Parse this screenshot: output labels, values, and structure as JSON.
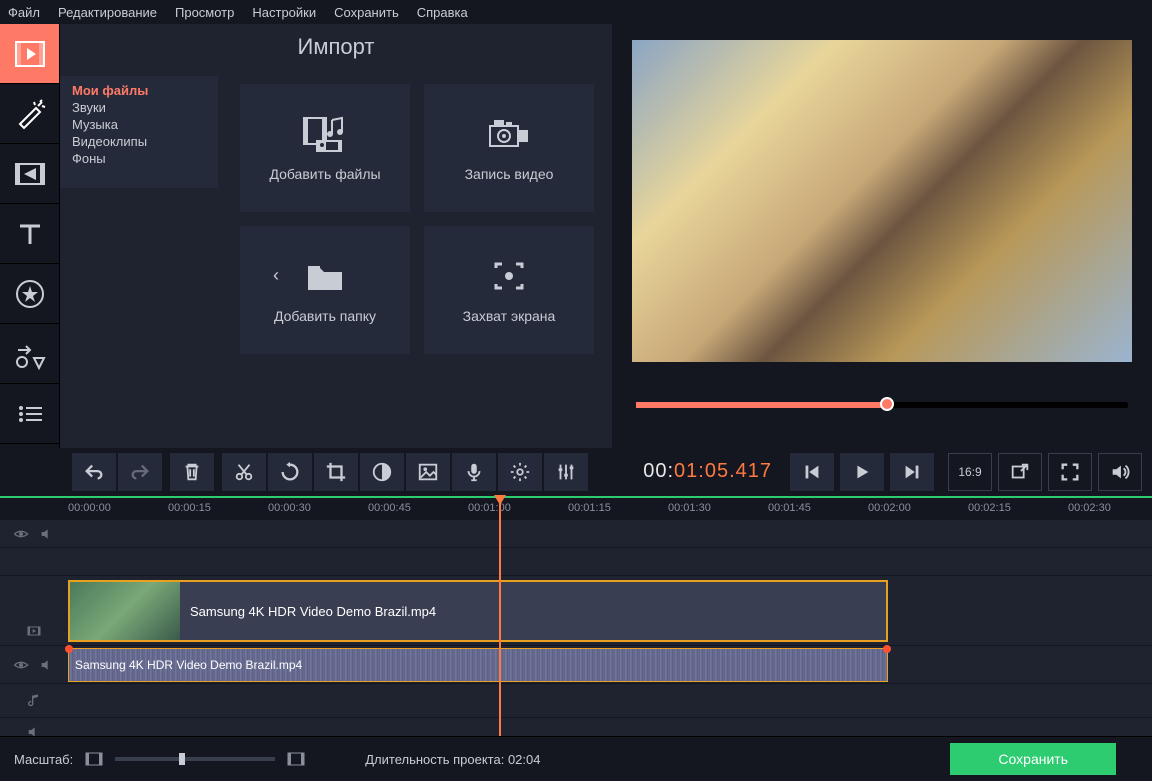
{
  "menubar": [
    "Файл",
    "Редактирование",
    "Просмотр",
    "Настройки",
    "Сохранить",
    "Справка"
  ],
  "panel_title": "Импорт",
  "subtabs": [
    "Мои файлы",
    "Звуки",
    "Музыка",
    "Видеоклипы",
    "Фоны"
  ],
  "import_buttons": {
    "add_files": "Добавить файлы",
    "record_video": "Запись видео",
    "add_folder": "Добавить папку",
    "screen_capture": "Захват экрана"
  },
  "timecode_prefix": "00:",
  "timecode_main": "01:05.417",
  "aspect_label": "16:9",
  "ruler_marks": [
    "00:00:00",
    "00:00:15",
    "00:00:30",
    "00:00:45",
    "00:01:00",
    "00:01:15",
    "00:01:30",
    "00:01:45",
    "00:02:00",
    "00:02:15",
    "00:02:30"
  ],
  "video_clip_name": "Samsung 4K HDR Video  Demo  Brazil.mp4",
  "audio_clip_name": "Samsung 4K HDR Video  Demo  Brazil.mp4",
  "footer": {
    "zoom_label": "Масштаб:",
    "duration_label": "Длительность проекта:",
    "duration_value": "02:04",
    "save_label": "Сохранить"
  }
}
